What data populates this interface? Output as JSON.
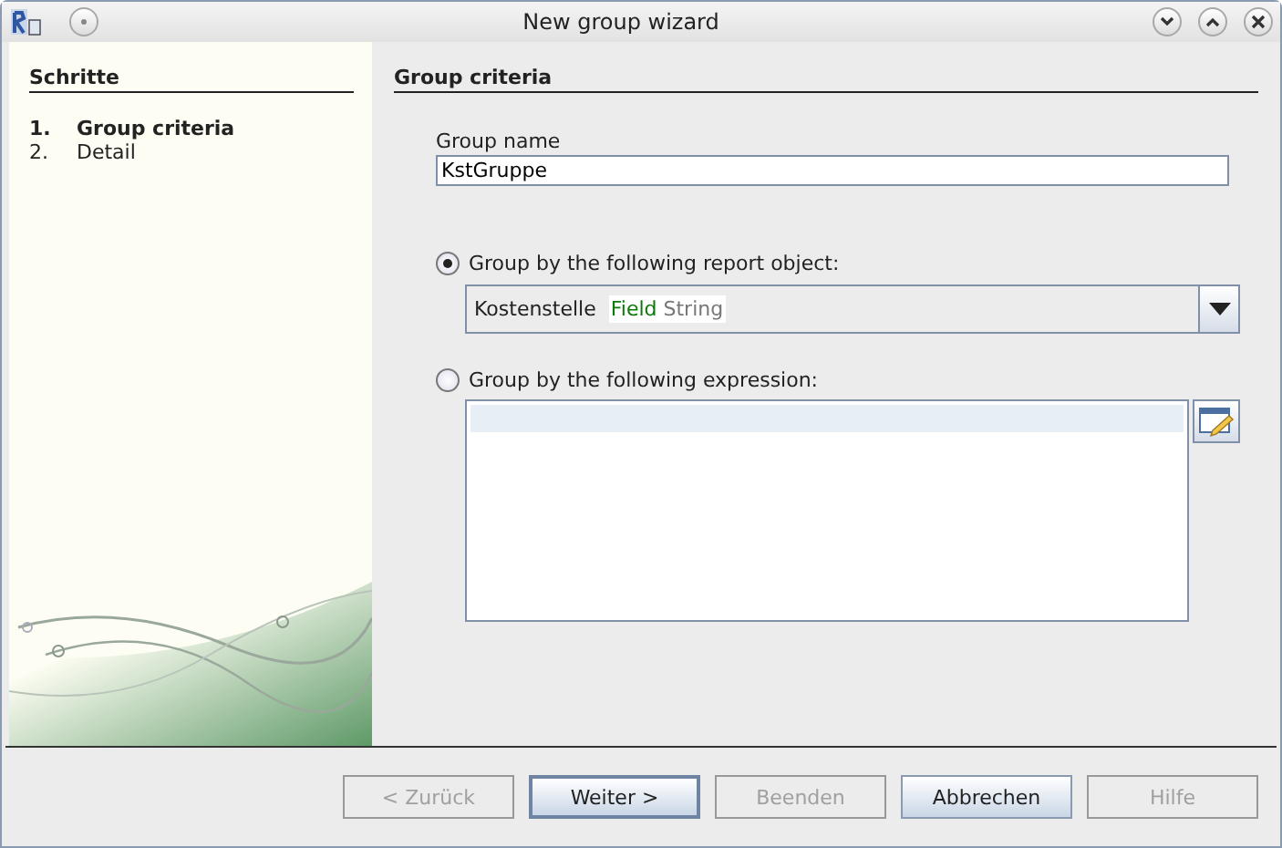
{
  "window": {
    "title": "New group wizard"
  },
  "sidebar": {
    "title": "Schritte",
    "steps": [
      {
        "number": "1.",
        "label": "Group criteria",
        "selected": true
      },
      {
        "number": "2.",
        "label": "Detail",
        "selected": false
      }
    ]
  },
  "panel": {
    "title": "Group criteria",
    "group_name": {
      "label": "Group name",
      "value": "KstGruppe"
    },
    "options": [
      {
        "label": "Group by the following report object:",
        "selected": true
      },
      {
        "label": "Group by the following expression:",
        "selected": false
      }
    ],
    "report_object": {
      "value": "Kostenstelle",
      "type_kind": "Field",
      "type_name": "String"
    }
  },
  "buttons": [
    {
      "label": "< Zurück",
      "disabled": true,
      "default": false
    },
    {
      "label": "Weiter >",
      "disabled": false,
      "default": true
    },
    {
      "label": "Beenden",
      "disabled": true,
      "default": false
    },
    {
      "label": "Abbrechen",
      "disabled": false,
      "default": false
    },
    {
      "label": "Hilfe",
      "disabled": true,
      "default": false
    }
  ]
}
